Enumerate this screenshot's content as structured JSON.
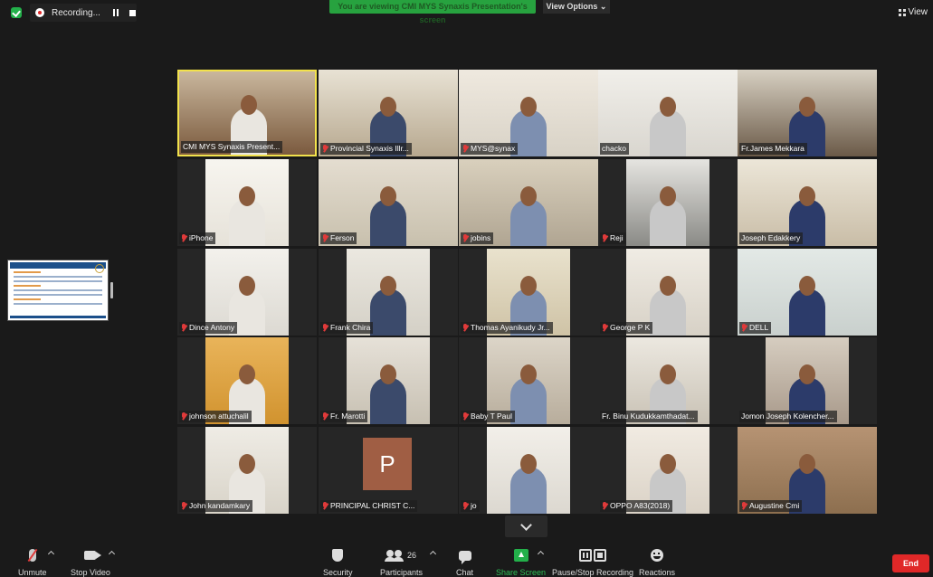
{
  "top": {
    "recording_label": "Recording...",
    "banner_text": "You are viewing CMI MYS Synaxis Presentation's screen",
    "view_options_label": "View Options ⌄",
    "view_label": "View"
  },
  "participants": [
    {
      "name": "CMI MYS Synaxis Present...",
      "muted": false,
      "bg": "#7b5a3e",
      "wall": "#c9b79d"
    },
    {
      "name": "Provincial Synaxis Illr...",
      "muted": true,
      "bg": "#b7a88f",
      "wall": "#e8e2d4"
    },
    {
      "name": "MYS@synax",
      "muted": true,
      "bg": "#d8d2c6",
      "wall": "#efe9df"
    },
    {
      "name": "chacko",
      "muted": false,
      "bg": "#d9d6cf",
      "wall": "#f1efea"
    },
    {
      "name": "Fr.James Mekkara",
      "muted": false,
      "bg": "#6b5a48",
      "wall": "#d7d0c2"
    },
    {
      "name": "iPhone",
      "muted": true,
      "bg": "#e6e2d9",
      "wall": "#f7f5ef"
    },
    {
      "name": "Ferson",
      "muted": true,
      "bg": "#c8c0ad",
      "wall": "#e4ddd0"
    },
    {
      "name": "jobins",
      "muted": true,
      "bg": "#b0a592",
      "wall": "#d9d0bd"
    },
    {
      "name": "Reji",
      "muted": true,
      "bg": "#8a8a86",
      "wall": "#e5e4e0"
    },
    {
      "name": "Joseph Edakkery",
      "muted": false,
      "bg": "#c9bda7",
      "wall": "#ece6d8"
    },
    {
      "name": "Dince Antony",
      "muted": true,
      "bg": "#dcd9d2",
      "wall": "#f3f1ec"
    },
    {
      "name": "Frank Chira",
      "muted": true,
      "bg": "#d4d0c6",
      "wall": "#ebe8e0"
    },
    {
      "name": "Thomas Ayanikudy Jr...",
      "muted": true,
      "bg": "#cfc3a6",
      "wall": "#e9e2cd"
    },
    {
      "name": "George P K",
      "muted": true,
      "bg": "#d7d1c6",
      "wall": "#f0ece4"
    },
    {
      "name": "DELL",
      "muted": true,
      "bg": "#c9d0cd",
      "wall": "#e3e9e6"
    },
    {
      "name": "johnson attuchalil",
      "muted": true,
      "bg": "#d1932f",
      "wall": "#e9b45a"
    },
    {
      "name": "Fr. Marotti",
      "muted": true,
      "bg": "#c7c0b2",
      "wall": "#e6e1d8"
    },
    {
      "name": "Baby T Paul",
      "muted": true,
      "bg": "#b8ad9c",
      "wall": "#dcd5c8"
    },
    {
      "name": "Fr. Binu Kudukkamthadat...",
      "muted": false,
      "bg": "#c9c2b5",
      "wall": "#ece8e0"
    },
    {
      "name": "Jomon Joseph Kolencher...",
      "muted": false,
      "bg": "#a8998a",
      "wall": "#d6cdc0"
    },
    {
      "name": "John kandamkary",
      "muted": true,
      "bg": "#d8d3c8",
      "wall": "#efece5"
    },
    {
      "name": "PRINCIPAL CHRIST C...",
      "muted": true,
      "avatar": "P"
    },
    {
      "name": "jo",
      "muted": true,
      "bg": "#dcd8d0",
      "wall": "#f2efe9"
    },
    {
      "name": "OPPO A83(2018)",
      "muted": true,
      "bg": "#dad2c6",
      "wall": "#f1ebe2"
    },
    {
      "name": "Augustine Cmi",
      "muted": true,
      "bg": "#8d6f4f",
      "wall": "#b69373"
    }
  ],
  "toolbar": {
    "unmute": "Unmute",
    "stop_video": "Stop Video",
    "security": "Security",
    "participants": "Participants",
    "participants_count": "26",
    "chat": "Chat",
    "share_screen": "Share Screen",
    "pause_stop_recording": "Pause/Stop Recording",
    "reactions": "Reactions",
    "end": "End"
  },
  "colors": {
    "accent_green": "#23b04a",
    "end_red": "#e02828",
    "active_speaker": "#f2e24c"
  }
}
